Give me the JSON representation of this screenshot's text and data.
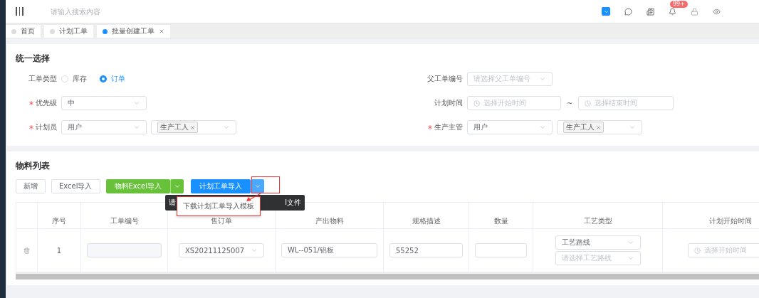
{
  "header": {
    "search_placeholder": "请输入搜索内容",
    "notification_badge": "99+"
  },
  "tabs": [
    {
      "label": "首页",
      "selected": false
    },
    {
      "label": "计划工单",
      "selected": false
    },
    {
      "label": "批量创建工单",
      "selected": true
    }
  ],
  "unified_selection": {
    "title": "统一选择",
    "rows": [
      [
        {
          "kind": "radio",
          "label": "工单类型",
          "required": false,
          "options": [
            {
              "label": "库存",
              "selected": false
            },
            {
              "label": "订单",
              "selected": true
            }
          ]
        },
        {
          "kind": "select",
          "label": "父工单编号",
          "required": false,
          "placeholder": "请选择父工单编号"
        }
      ],
      [
        {
          "kind": "select",
          "label": "优先级",
          "required": true,
          "value": "中"
        },
        {
          "kind": "date_range",
          "label": "计划时间",
          "required": false,
          "start_placeholder": "选择开始时间",
          "separator": "~",
          "end_placeholder": "选择结束时间"
        }
      ],
      [
        {
          "kind": "select_pair",
          "label": "计划员",
          "required": true,
          "value": "用户",
          "tag": "生产工人"
        },
        {
          "kind": "select_pair",
          "label": "生产主管",
          "required": true,
          "value": "用户",
          "tag": "生产工人"
        }
      ]
    ]
  },
  "material_list": {
    "title": "物料列表",
    "buttons": [
      {
        "label": "新增",
        "kind": "plain"
      },
      {
        "label": "Excel导入",
        "kind": "plain"
      },
      {
        "label": "物料Excel导入",
        "kind": "green_split"
      },
      {
        "label": "计划工单导入",
        "kind": "blue_split"
      }
    ],
    "tooltip": {
      "text_left": "请",
      "text_right": "l文件"
    },
    "dropdown_menu": {
      "items": [
        "下载计划工单导入模板"
      ]
    },
    "columns": [
      "序号",
      "工单编号",
      "售订单",
      "产出物料",
      "规格描述",
      "数量",
      "工艺类型",
      "计划开始时间"
    ],
    "rows": [
      {
        "index": "1",
        "order_no": "",
        "sales_order": "XS20211125007",
        "material": "WL--051/铝板",
        "spec": "55252",
        "quantity": "",
        "process_type": "工艺路线",
        "process_route_placeholder": "请选择工艺路线",
        "start_time_placeholder": "选择开始时间"
      }
    ]
  }
}
